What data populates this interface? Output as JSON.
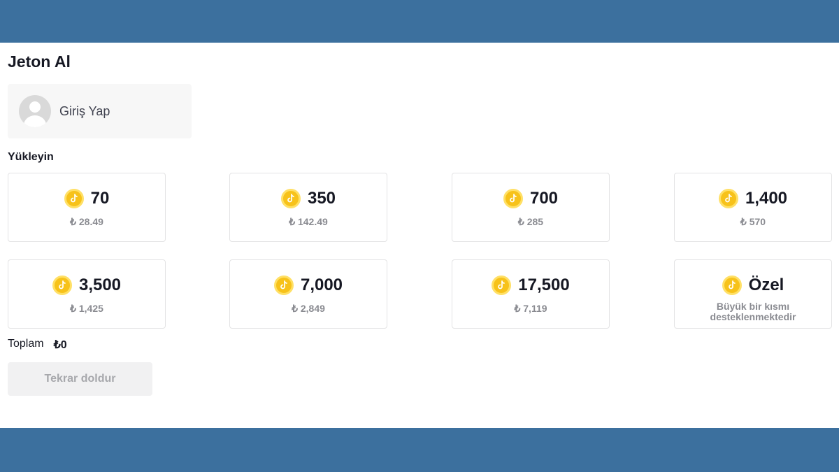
{
  "page": {
    "title": "Jeton Al"
  },
  "login": {
    "label": "Giriş Yap"
  },
  "recharge": {
    "section_label": "Yükleyin",
    "packages": [
      {
        "amount": "70",
        "price": "₺ 28.49"
      },
      {
        "amount": "350",
        "price": "₺ 142.49"
      },
      {
        "amount": "700",
        "price": "₺ 285"
      },
      {
        "amount": "1,400",
        "price": "₺ 570"
      },
      {
        "amount": "3,500",
        "price": "₺ 1,425"
      },
      {
        "amount": "7,000",
        "price": "₺ 2,849"
      },
      {
        "amount": "17,500",
        "price": "₺ 7,119"
      }
    ],
    "custom": {
      "amount": "Özel",
      "desc": "Büyük bir kısmı desteklenmektedir"
    }
  },
  "summary": {
    "total_label": "Toplam",
    "total_value": "₺0"
  },
  "actions": {
    "recharge_button": "Tekrar doldur"
  },
  "colors": {
    "band": "#3c709e",
    "coin": "#f7c21a",
    "coin_ring": "#ffe066"
  },
  "icons": {
    "coin": "tiktok-coin-icon",
    "avatar": "default-avatar-icon"
  }
}
